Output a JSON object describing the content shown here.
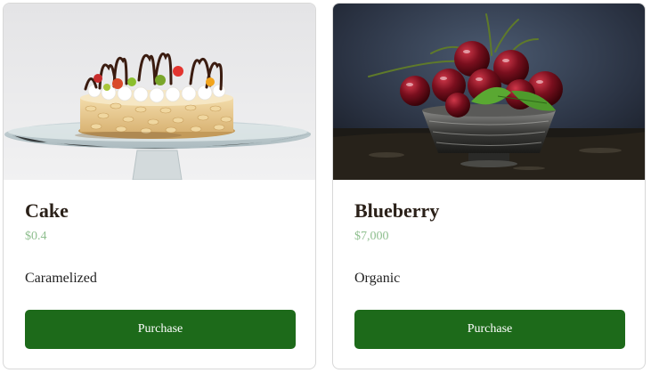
{
  "products": [
    {
      "title": "Cake",
      "price": "$0.4",
      "description": "Caramelized",
      "button_label": "Purchase",
      "image": "cake-photo"
    },
    {
      "title": "Blueberry",
      "price": "$7,000",
      "description": "Organic",
      "button_label": "Purchase",
      "image": "cherries-in-bowl-photo"
    }
  ],
  "colors": {
    "button_bg": "#1d6a1a",
    "price_text": "#8fbf8f",
    "title_text": "#2a2018"
  }
}
